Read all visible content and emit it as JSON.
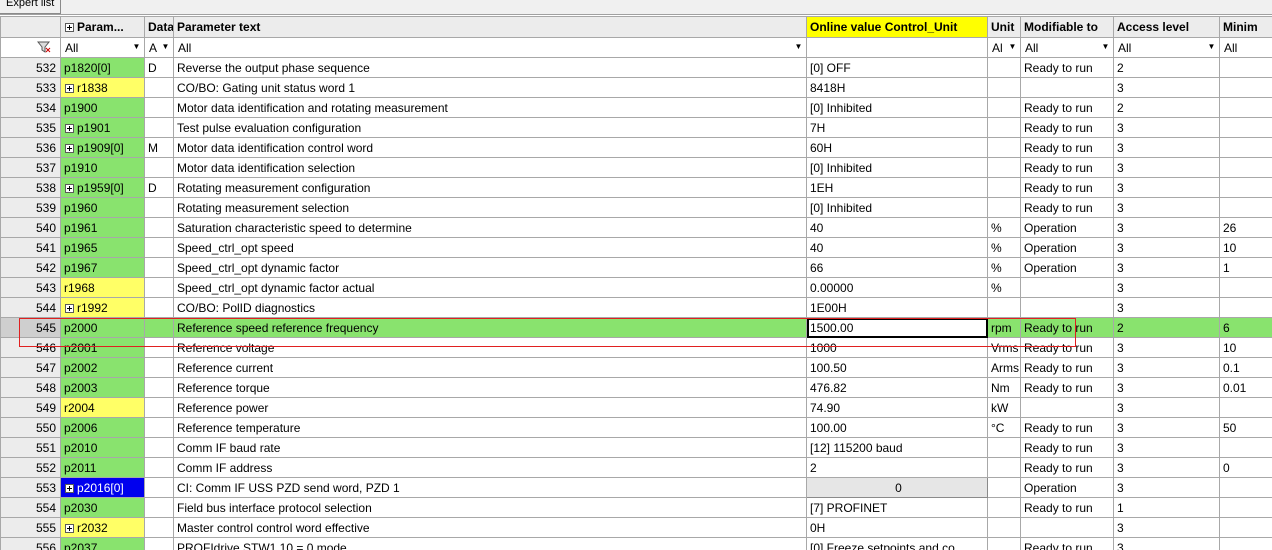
{
  "tab": "Expert list",
  "headers": [
    "",
    "Param...",
    "Data",
    "Parameter text",
    "Online value Control_Unit",
    "Unit",
    "Modifiable to",
    "Access level",
    "Minim"
  ],
  "filters": {
    "param": "All",
    "data": "A",
    "text": "All",
    "unit": "Al",
    "modifiable": "All",
    "access": "All",
    "min": "All"
  },
  "rows": [
    {
      "idx": "532",
      "param": "p1820[0]",
      "color": "green",
      "expand": false,
      "data": "D",
      "text": "Reverse the output phase sequence",
      "value": "[0] OFF",
      "unit": "",
      "mod": "Ready to run",
      "access": "2",
      "min": ""
    },
    {
      "idx": "533",
      "param": "r1838",
      "color": "yellow",
      "expand": true,
      "data": "",
      "text": "CO/BO: Gating unit status word 1",
      "value": "8418H",
      "unit": "",
      "mod": "",
      "access": "3",
      "min": ""
    },
    {
      "idx": "534",
      "param": "p1900",
      "color": "green",
      "expand": false,
      "data": "",
      "text": "Motor data identification and rotating measurement",
      "value": "[0] Inhibited",
      "unit": "",
      "mod": "Ready to run",
      "access": "2",
      "min": ""
    },
    {
      "idx": "535",
      "param": "p1901",
      "color": "green",
      "expand": true,
      "data": "",
      "text": "Test pulse evaluation configuration",
      "value": "7H",
      "unit": "",
      "mod": "Ready to run",
      "access": "3",
      "min": ""
    },
    {
      "idx": "536",
      "param": "p1909[0]",
      "color": "green",
      "expand": true,
      "data": "M",
      "text": "Motor data identification control word",
      "value": "60H",
      "unit": "",
      "mod": "Ready to run",
      "access": "3",
      "min": ""
    },
    {
      "idx": "537",
      "param": "p1910",
      "color": "green",
      "expand": false,
      "data": "",
      "text": "Motor data identification selection",
      "value": "[0] Inhibited",
      "unit": "",
      "mod": "Ready to run",
      "access": "3",
      "min": ""
    },
    {
      "idx": "538",
      "param": "p1959[0]",
      "color": "green",
      "expand": true,
      "data": "D",
      "text": "Rotating measurement configuration",
      "value": "1EH",
      "unit": "",
      "mod": "Ready to run",
      "access": "3",
      "min": ""
    },
    {
      "idx": "539",
      "param": "p1960",
      "color": "green",
      "expand": false,
      "data": "",
      "text": "Rotating measurement selection",
      "value": "[0] Inhibited",
      "unit": "",
      "mod": "Ready to run",
      "access": "3",
      "min": ""
    },
    {
      "idx": "540",
      "param": "p1961",
      "color": "green",
      "expand": false,
      "data": "",
      "text": "Saturation characteristic speed to determine",
      "value": "40",
      "unit": "%",
      "mod": "Operation",
      "access": "3",
      "min": "26"
    },
    {
      "idx": "541",
      "param": "p1965",
      "color": "green",
      "expand": false,
      "data": "",
      "text": "Speed_ctrl_opt speed",
      "value": "40",
      "unit": "%",
      "mod": "Operation",
      "access": "3",
      "min": "10"
    },
    {
      "idx": "542",
      "param": "p1967",
      "color": "green",
      "expand": false,
      "data": "",
      "text": "Speed_ctrl_opt dynamic factor",
      "value": "66",
      "unit": "%",
      "mod": "Operation",
      "access": "3",
      "min": "1"
    },
    {
      "idx": "543",
      "param": "r1968",
      "color": "yellow",
      "expand": false,
      "data": "",
      "text": "Speed_ctrl_opt dynamic factor actual",
      "value": "0.00000",
      "unit": "%",
      "mod": "",
      "access": "3",
      "min": ""
    },
    {
      "idx": "544",
      "param": "r1992",
      "color": "yellow",
      "expand": true,
      "data": "",
      "text": "CO/BO: PolID diagnostics",
      "value": "1E00H",
      "unit": "",
      "mod": "",
      "access": "3",
      "min": ""
    },
    {
      "idx": "545",
      "param": "p2000",
      "color": "green",
      "expand": false,
      "data": "",
      "text": "Reference speed reference frequency",
      "value": "1500.00",
      "unit": "rpm",
      "mod": "Ready to run",
      "access": "2",
      "min": "6",
      "selected": true
    },
    {
      "idx": "546",
      "param": "p2001",
      "color": "green",
      "expand": false,
      "data": "",
      "text": "Reference voltage",
      "value": "1000",
      "unit": "Vrms",
      "mod": "Ready to run",
      "access": "3",
      "min": "10"
    },
    {
      "idx": "547",
      "param": "p2002",
      "color": "green",
      "expand": false,
      "data": "",
      "text": "Reference current",
      "value": "100.50",
      "unit": "Arms",
      "mod": "Ready to run",
      "access": "3",
      "min": "0.1"
    },
    {
      "idx": "548",
      "param": "p2003",
      "color": "green",
      "expand": false,
      "data": "",
      "text": "Reference torque",
      "value": "476.82",
      "unit": "Nm",
      "mod": "Ready to run",
      "access": "3",
      "min": "0.01"
    },
    {
      "idx": "549",
      "param": "r2004",
      "color": "yellow",
      "expand": false,
      "data": "",
      "text": "Reference power",
      "value": "74.90",
      "unit": "kW",
      "mod": "",
      "access": "3",
      "min": ""
    },
    {
      "idx": "550",
      "param": "p2006",
      "color": "green",
      "expand": false,
      "data": "",
      "text": "Reference temperature",
      "value": "100.00",
      "unit": "°C",
      "mod": "Ready to run",
      "access": "3",
      "min": "50"
    },
    {
      "idx": "551",
      "param": "p2010",
      "color": "green",
      "expand": false,
      "data": "",
      "text": "Comm IF baud rate",
      "value": "[12] 115200 baud",
      "unit": "",
      "mod": "Ready to run",
      "access": "3",
      "min": ""
    },
    {
      "idx": "552",
      "param": "p2011",
      "color": "green",
      "expand": false,
      "data": "",
      "text": "Comm IF address",
      "value": "2",
      "unit": "",
      "mod": "Ready to run",
      "access": "3",
      "min": "0"
    },
    {
      "idx": "553",
      "param": "p2016[0]",
      "color": "blue",
      "expand": true,
      "data": "",
      "text": "CI: Comm IF USS PZD send word, PZD 1",
      "value": "0",
      "unit": "",
      "mod": "Operation",
      "access": "3",
      "min": "",
      "button": true
    },
    {
      "idx": "554",
      "param": "p2030",
      "color": "green",
      "expand": false,
      "data": "",
      "text": "Field bus interface protocol selection",
      "value": "[7] PROFINET",
      "unit": "",
      "mod": "Ready to run",
      "access": "1",
      "min": ""
    },
    {
      "idx": "555",
      "param": "r2032",
      "color": "yellow",
      "expand": true,
      "data": "",
      "text": "Master control control word effective",
      "value": "0H",
      "unit": "",
      "mod": "",
      "access": "3",
      "min": ""
    },
    {
      "idx": "556",
      "param": "p2037",
      "color": "green",
      "expand": false,
      "data": "",
      "text": "PROFIdrive STW1.10 = 0 mode",
      "value": "[0] Freeze setpoints and co",
      "unit": "",
      "mod": "Ready to run",
      "access": "3",
      "min": ""
    }
  ]
}
